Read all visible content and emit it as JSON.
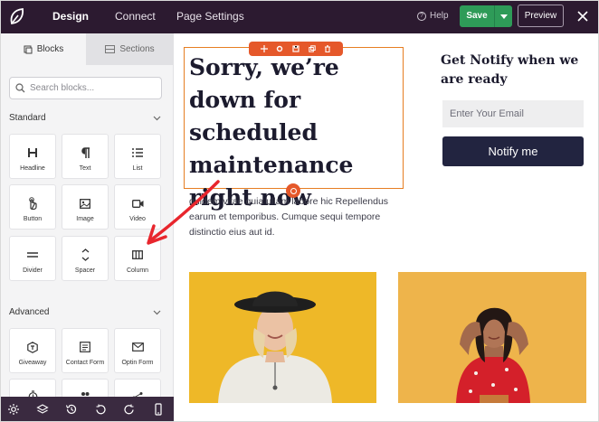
{
  "topbar": {
    "tabs": [
      {
        "label": "Design"
      },
      {
        "label": "Connect"
      },
      {
        "label": "Page Settings"
      }
    ],
    "help_label": "Help",
    "save_label": "Save",
    "preview_label": "Preview"
  },
  "sidebar": {
    "tabs": [
      {
        "label": "Blocks"
      },
      {
        "label": "Sections"
      }
    ],
    "search": {
      "placeholder": "Search blocks..."
    },
    "standard": {
      "title": "Standard",
      "items": [
        {
          "label": "Headline",
          "icon": "headline-icon"
        },
        {
          "label": "Text",
          "icon": "paragraph-icon"
        },
        {
          "label": "List",
          "icon": "list-icon"
        },
        {
          "label": "Button",
          "icon": "pointer-icon"
        },
        {
          "label": "Image",
          "icon": "image-icon"
        },
        {
          "label": "Video",
          "icon": "video-icon"
        },
        {
          "label": "Divider",
          "icon": "divider-icon"
        },
        {
          "label": "Spacer",
          "icon": "spacer-icon"
        },
        {
          "label": "Column",
          "icon": "column-icon"
        }
      ]
    },
    "advanced": {
      "title": "Advanced",
      "items": [
        {
          "label": "Giveaway",
          "icon": "giveaway-icon"
        },
        {
          "label": "Contact Form",
          "icon": "contact-form-icon"
        },
        {
          "label": "Optin Form",
          "icon": "envelope-icon"
        }
      ]
    }
  },
  "canvas": {
    "headline": "Sorry, we’re down for scheduled maintenance right now",
    "paragraph": "quidem vitae quia ullam labore hic Repellendus earum et temporibus. Cumque sequi tempore distinctio eius aut id.",
    "notify_title": "Get Notify when we are ready",
    "email_placeholder": "Enter Your Email",
    "notify_button": "Notify me"
  },
  "colors": {
    "topbar_bg": "#2c1a30",
    "save_green": "#2e9b58",
    "selection_orange": "#e5582a",
    "button_navy": "#222440",
    "photo_yellow": "#eeb828"
  }
}
